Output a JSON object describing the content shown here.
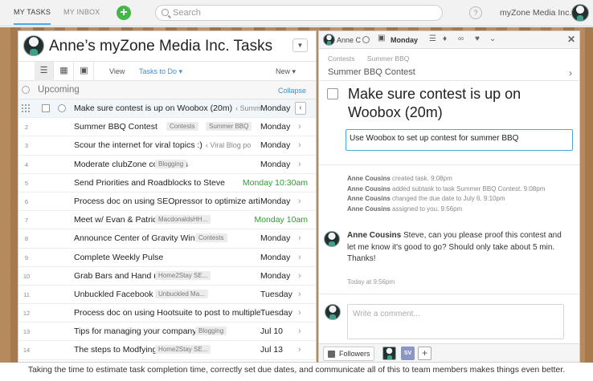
{
  "nav": {
    "tabs": [
      "MY TASKS",
      "MY INBOX"
    ],
    "search_placeholder": "Search",
    "help": "?",
    "org_name": "myZone Media Inc."
  },
  "list": {
    "title": "Anne’s myZone Media Inc. Tasks",
    "view_label": "View",
    "view_value": "Tasks to Do",
    "new_label": "New",
    "section": "Upcoming",
    "collapse": "Collapse",
    "rows": [
      {
        "num": "",
        "name": "Make sure contest is up on Woobox (20m)",
        "hint": "‹ Summ",
        "tag": "",
        "date": "Monday",
        "green": false
      },
      {
        "num": "2",
        "name": "Summer BBQ Contest",
        "hint": "",
        "tag": "Contests",
        "tag2": "Summer BBQ",
        "date": "Monday",
        "green": false
      },
      {
        "num": "3",
        "name": "Scour the internet for viral topics :)",
        "hint": "‹ Viral Blog po",
        "tag": "",
        "date": "Monday",
        "green": false
      },
      {
        "num": "4",
        "name": "Moderate clubZone comments",
        "hint": "",
        "tag": "Blogging",
        "date": "Monday",
        "green": false
      },
      {
        "num": "5",
        "name": "Send Priorities and Roadblocks to Steve",
        "hint": "",
        "tag": "",
        "date": "Monday 10:30am",
        "green": true
      },
      {
        "num": "6",
        "name": "Process doc on using SEOpressor to optimize artic",
        "hint": "",
        "tag": "",
        "date": "Monday",
        "green": false
      },
      {
        "num": "7",
        "name": "Meet w/ Evan & Patrick to",
        "hint": "",
        "tag": "MacdonaldsHH...",
        "date": "Monday 10am",
        "green": true
      },
      {
        "num": "8",
        "name": "Announce Center of Gravity Winner (30",
        "hint": "",
        "tag": "Contests",
        "date": "Monday",
        "green": false
      },
      {
        "num": "9",
        "name": "Complete Weekly Pulse",
        "hint": "",
        "tag": "",
        "date": "Monday",
        "green": false
      },
      {
        "num": "10",
        "name": "Grab Bars and Hand rails: A guid",
        "hint": "",
        "tag": "Home2Stay SE...",
        "date": "Monday",
        "green": false
      },
      {
        "num": "11",
        "name": "Unbuckled Facebook contest",
        "hint": "",
        "tag": "Unbuckled Ma...",
        "date": "Tuesday",
        "green": false
      },
      {
        "num": "12",
        "name": "Process doc on using Hootsuite to post to multiple",
        "hint": "",
        "tag": "",
        "date": "Tuesday",
        "green": false
      },
      {
        "num": "13",
        "name": "Tips for managing your company email",
        "hint": "",
        "tag": "Blogging",
        "date": "Jul 10",
        "green": false
      },
      {
        "num": "14",
        "name": "The steps to Modfying Your Bathro",
        "hint": "",
        "tag": "Home2Stay SE...",
        "date": "Jul 13",
        "green": false
      }
    ]
  },
  "detail": {
    "assignee": "Anne C",
    "due": "Monday",
    "breadcrumbs": [
      "Contests",
      "Summer BBQ"
    ],
    "parent": "Summer BBQ Contest",
    "title": "Make sure contest is up on Woobox (20m)",
    "description": "Use Woobox to set up contest for summer BBQ",
    "activity": [
      {
        "who": "Anne Cousins",
        "text": "created task.",
        "time": "9:08pm"
      },
      {
        "who": "Anne Cousins",
        "text": "added subtask to task Summer BBQ Contest.",
        "time": "9:08pm"
      },
      {
        "who": "Anne Cousins",
        "text": "changed the due date to July 6.",
        "time": "9:10pm"
      },
      {
        "who": "Anne Cousins",
        "text": "assigned to you.",
        "time": "9:56pm"
      }
    ],
    "comment": {
      "who": "Anne Cousins",
      "text": "Steve, can you please proof this contest and let me know it's good to go? Should only take about 5 min. Thanks!",
      "time": "Today at 9:56pm"
    },
    "compose_placeholder": "Write a comment...",
    "followers_label": "Followers",
    "follower_initials": "SV"
  },
  "caption": "Taking the time to estimate task completion time, correctly set due dates, and communicate all of this to team members makes things even better.",
  "colors": {
    "accent": "#4aa7e0",
    "green": "#2aa02a",
    "plus": "#45b649"
  }
}
